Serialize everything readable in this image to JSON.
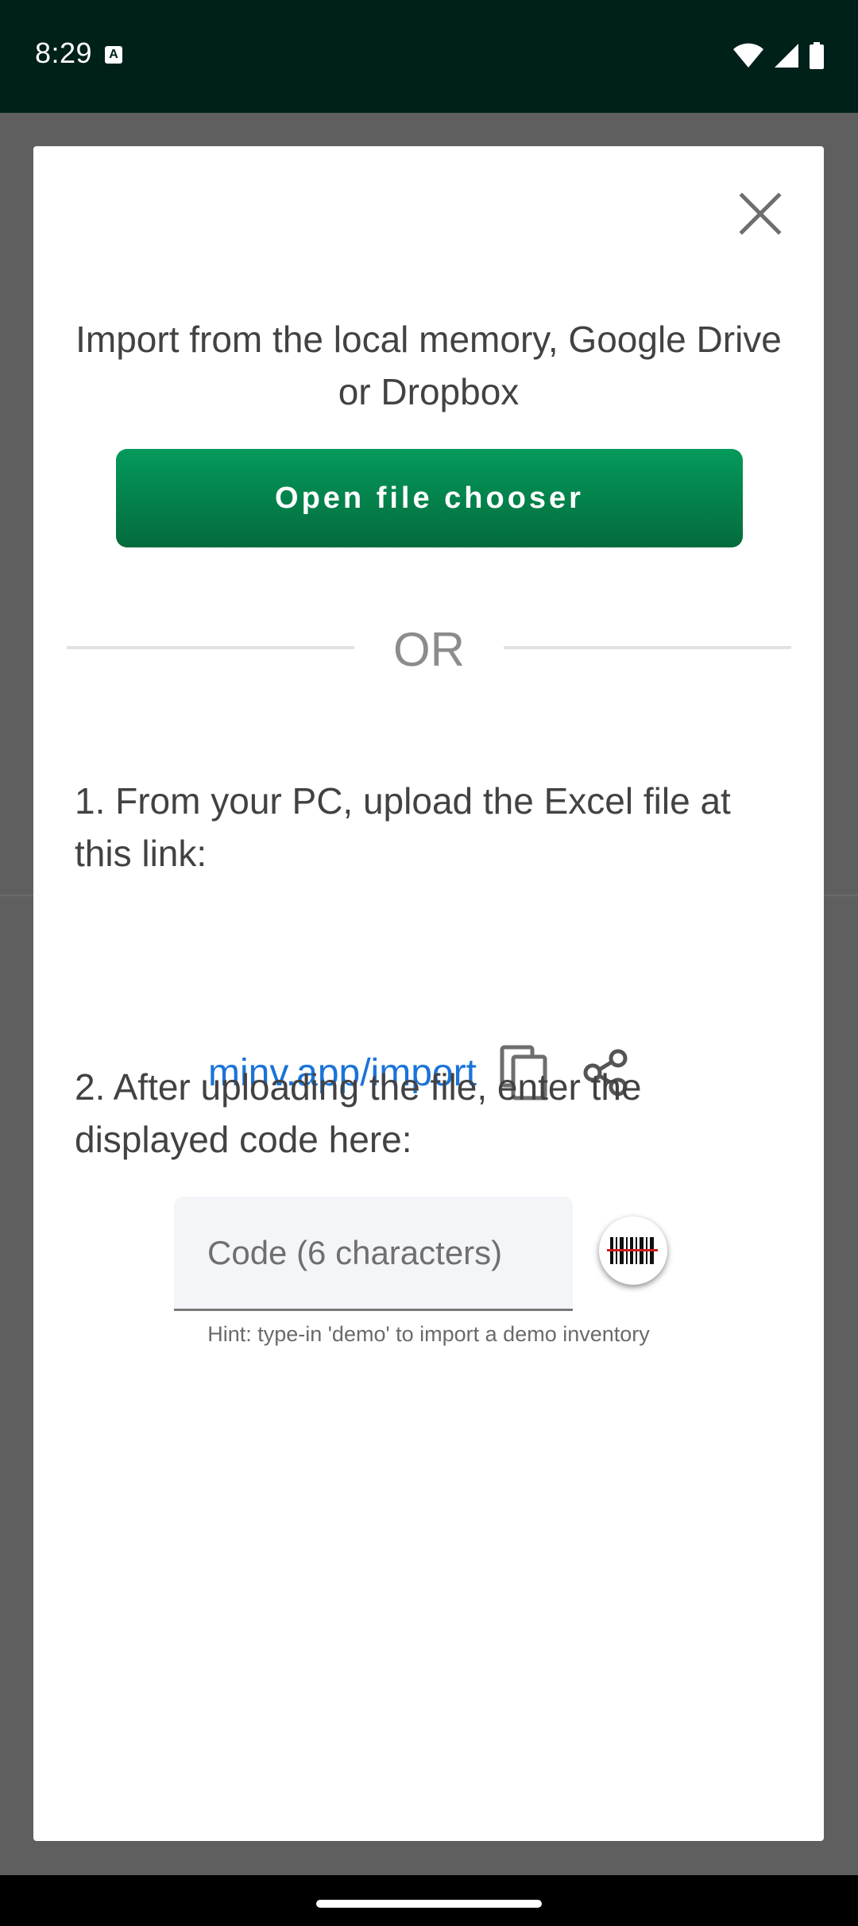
{
  "status_bar": {
    "time": "8:29",
    "notification_icon": "A",
    "icons": [
      "wifi-icon",
      "signal-icon",
      "battery-icon"
    ]
  },
  "dialog": {
    "title": "Import from the local memory, Google Drive or Dropbox",
    "open_button_label": "Open file chooser",
    "divider_label": "OR",
    "step1_text": "1. From your PC, upload the Excel file at this link:",
    "link_text": "minv.app/import",
    "step2_text": "2. After uploading the file, enter the displayed code here:",
    "code_placeholder": "Code (6 characters)",
    "hint": "Hint: type-in 'demo' to import a demo inventory"
  },
  "colors": {
    "status_bar_bg": "#00201a",
    "button_green": "#047a48",
    "link_blue": "#1a73d9",
    "scrim": "#5f5f5f"
  }
}
